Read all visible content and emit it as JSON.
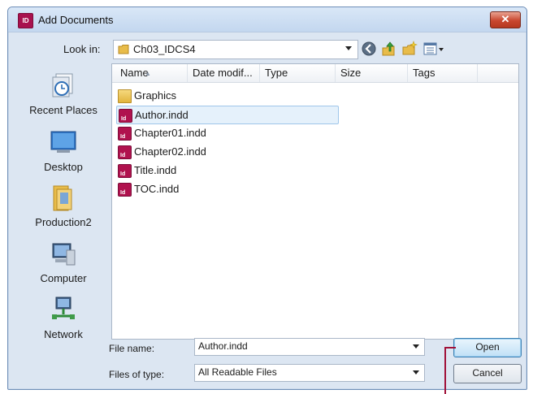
{
  "window": {
    "title": "Add Documents",
    "app_icon_text": "ID",
    "close_label": "✕"
  },
  "toolbar": {
    "lookin_label": "Look in:",
    "lookin_value": "Ch03_IDCS4",
    "icons": [
      "back-icon",
      "up-folder-icon",
      "new-folder-icon",
      "views-menu-icon"
    ]
  },
  "places": [
    {
      "label": "Recent Places",
      "icon": "recent-places-icon"
    },
    {
      "label": "Desktop",
      "icon": "desktop-icon"
    },
    {
      "label": "Production2",
      "icon": "user-folder-icon"
    },
    {
      "label": "Computer",
      "icon": "computer-icon"
    },
    {
      "label": "Network",
      "icon": "network-icon"
    }
  ],
  "columns": [
    "Name",
    "Date modif...",
    "Type",
    "Size",
    "Tags"
  ],
  "files": [
    {
      "name": "Graphics",
      "kind": "folder",
      "selected": false
    },
    {
      "name": "Author.indd",
      "kind": "indd",
      "selected": true
    },
    {
      "name": "Chapter01.indd",
      "kind": "indd",
      "selected": false
    },
    {
      "name": "Chapter02.indd",
      "kind": "indd",
      "selected": false
    },
    {
      "name": "Title.indd",
      "kind": "indd",
      "selected": false
    },
    {
      "name": "TOC.indd",
      "kind": "indd",
      "selected": false
    }
  ],
  "form": {
    "filename_label": "File name:",
    "filename_value": "Author.indd",
    "filetype_label": "Files of type:",
    "filetype_value": "All Readable Files",
    "open_label": "Open",
    "cancel_label": "Cancel"
  },
  "colors": {
    "accent_callout": "#a01038",
    "selection": "#e5f1fb"
  }
}
